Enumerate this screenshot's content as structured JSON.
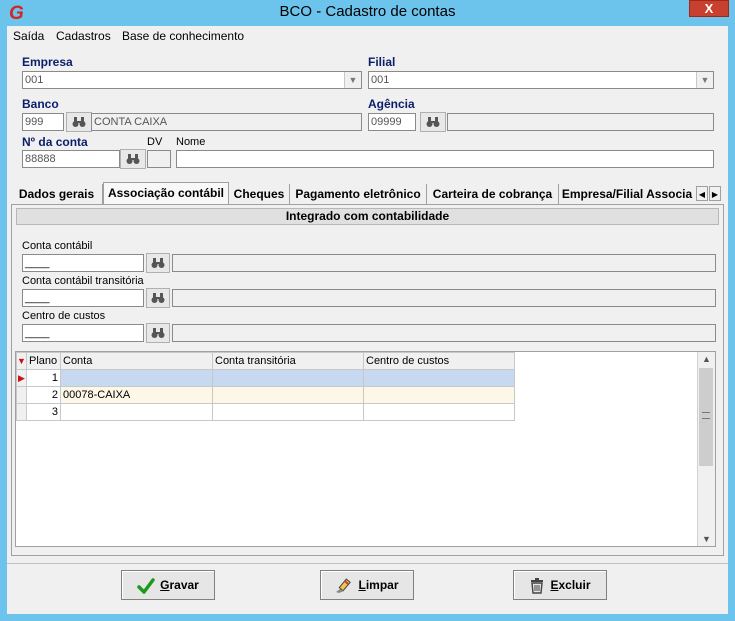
{
  "window": {
    "title": "BCO - Cadastro de contas",
    "close": "X"
  },
  "menu": [
    "Saída",
    "Cadastros",
    "Base de conhecimento"
  ],
  "form": {
    "empresa_label": "Empresa",
    "empresa_value": "001",
    "filial_label": "Filial",
    "filial_value": "001",
    "banco_label": "Banco",
    "banco_code": "999",
    "banco_name": "CONTA CAIXA",
    "agencia_label": "Agência",
    "agencia_code": "09999",
    "conta_label": "Nº da conta",
    "conta_value": "88888",
    "dv_label": "DV",
    "nome_label": "Nome",
    "nome_value": ""
  },
  "tabs": [
    "Dados gerais",
    "Associação contábil",
    "Cheques",
    "Pagamento eletrônico",
    "Carteira de cobrança",
    "Empresa/Filial Associa"
  ],
  "active_tab": "Associação contábil",
  "section": {
    "title": "Integrado com contabilidade",
    "conta_contabil_label": "Conta contábil",
    "conta_transitoria_label": "Conta contábil transitória",
    "centro_custos_label": "Centro de custos",
    "mask": "____"
  },
  "grid": {
    "columns": [
      "Plano",
      "Conta",
      "Conta transitória",
      "Centro de custos"
    ],
    "rows": [
      {
        "plano": "1",
        "conta": "",
        "transitoria": "",
        "centro": ""
      },
      {
        "plano": "2",
        "conta": "00078-CAIXA",
        "transitoria": "",
        "centro": ""
      },
      {
        "plano": "3",
        "conta": "",
        "transitoria": "",
        "centro": ""
      }
    ]
  },
  "buttons": {
    "gravar_u": "G",
    "gravar": "ravar",
    "limpar_u": "L",
    "limpar": "impar",
    "excluir_u": "E",
    "excluir": "xcluir"
  },
  "colors": {
    "titlebar": "#6cc4ec",
    "label_blue": "#0a1e6a",
    "selected_row": "#c6d9f1",
    "alt_row": "#fdf7e8"
  }
}
